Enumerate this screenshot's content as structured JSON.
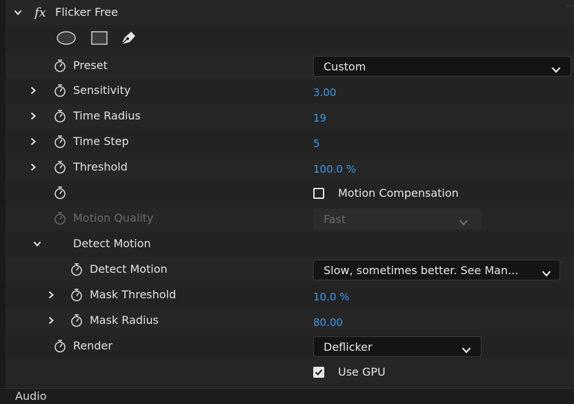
{
  "effect": {
    "name": "Flicker Free",
    "fx_symbol": "fx"
  },
  "mask_tools": [
    "ellipse-mask-icon",
    "rectangle-mask-icon",
    "pen-mask-icon"
  ],
  "properties": {
    "preset": {
      "label": "Preset",
      "value": "Custom"
    },
    "sensitivity": {
      "label": "Sensitivity",
      "value": "3.00"
    },
    "time_radius": {
      "label": "Time Radius",
      "value": "19"
    },
    "time_step": {
      "label": "Time Step",
      "value": "5"
    },
    "threshold": {
      "label": "Threshold",
      "value": "100.0 %"
    },
    "motion_compensation": {
      "label": "Motion Compensation",
      "checked": false
    },
    "motion_quality": {
      "label": "Motion Quality",
      "value": "Fast",
      "disabled": true
    },
    "detect_motion_group": {
      "label": "Detect Motion"
    },
    "detect_motion": {
      "label": "Detect Motion",
      "value": "Slow, sometimes better. See Man..."
    },
    "mask_threshold": {
      "label": "Mask Threshold",
      "value": "10.0 %"
    },
    "mask_radius": {
      "label": "Mask Radius",
      "value": "80.00"
    },
    "render": {
      "label": "Render",
      "value": "Deflicker"
    },
    "use_gpu": {
      "label": "Use GPU",
      "checked": true
    }
  },
  "footer": {
    "section": "Audio"
  },
  "colors": {
    "accent_value": "#3c9ae8",
    "panel_bg": "#232323",
    "text": "#e2e2e2"
  }
}
